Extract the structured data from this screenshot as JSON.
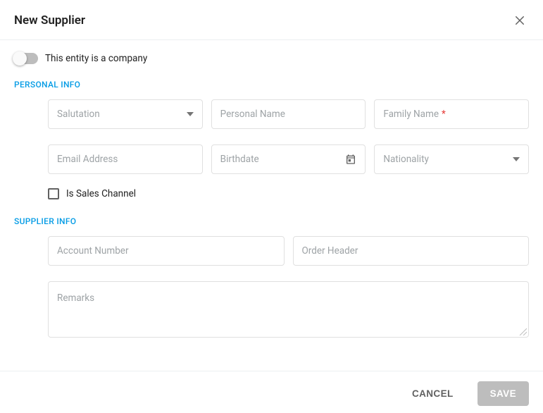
{
  "header": {
    "title": "New Supplier"
  },
  "toggle": {
    "label": "This entity is a company"
  },
  "sections": {
    "personal": {
      "label": "PERSONAL INFO",
      "salutation": {
        "placeholder": "Salutation"
      },
      "personal_name": {
        "placeholder": "Personal Name"
      },
      "family_name": {
        "placeholder": "Family Name",
        "required_marker": "*"
      },
      "email": {
        "placeholder": "Email Address"
      },
      "birthdate": {
        "placeholder": "Birthdate"
      },
      "nationality": {
        "placeholder": "Nationality"
      },
      "is_sales_channel": {
        "label": "Is Sales Channel"
      }
    },
    "supplier": {
      "label": "SUPPLIER INFO",
      "account_number": {
        "placeholder": "Account Number"
      },
      "order_header": {
        "placeholder": "Order Header"
      },
      "remarks": {
        "placeholder": "Remarks"
      }
    }
  },
  "footer": {
    "cancel": "CANCEL",
    "save": "SAVE"
  }
}
